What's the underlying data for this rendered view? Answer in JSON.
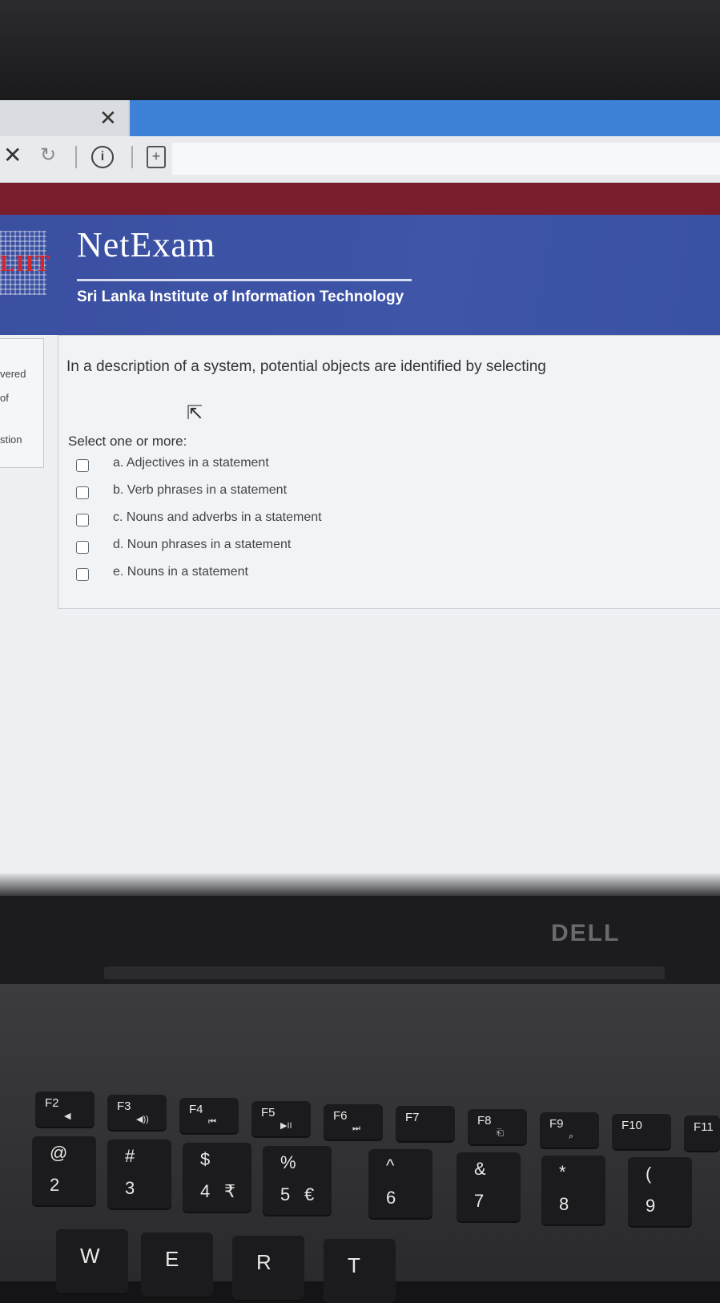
{
  "browser": {
    "tab_close_icon": "close-icon",
    "toolbar_icons": [
      "stop-icon",
      "reload-icon",
      "site-info-icon",
      "extension-icon"
    ]
  },
  "header": {
    "logo_text": "LIIT",
    "brand": "NetExam",
    "institute": "Sri Lanka Institute of Information Technology"
  },
  "sidebar": {
    "line1": "vered",
    "line2": "of",
    "line3": "stion"
  },
  "question": {
    "text": "In a description of a system,  potential objects are identified by selecting",
    "prompt": "Select one or more:",
    "answers": [
      {
        "label": "a. Adjectives in a statement",
        "checked": false
      },
      {
        "label": "b. Verb phrases in a statement",
        "checked": false
      },
      {
        "label": "c. Nouns and adverbs in a statement",
        "checked": false
      },
      {
        "label": "d. Noun phrases in a statement",
        "checked": false
      },
      {
        "label": "e. Nouns in a statement",
        "checked": false
      }
    ]
  },
  "laptop": {
    "brand": "DELL",
    "fkeys": [
      "F2",
      "F3",
      "F4",
      "F5",
      "F6",
      "F7",
      "F8",
      "F9",
      "F10",
      "F11"
    ],
    "fkey_icons": [
      "◀",
      "◀))",
      "⏮",
      "▶II",
      "⏭",
      "",
      "⎗",
      "⌕",
      "",
      ""
    ],
    "number_keys": [
      {
        "top": "@",
        "bottom": "2",
        "alt": ""
      },
      {
        "top": "#",
        "bottom": "3",
        "alt": ""
      },
      {
        "top": "$",
        "bottom": "4",
        "alt": "₹"
      },
      {
        "top": "%",
        "bottom": "5",
        "alt": "€"
      },
      {
        "top": "^",
        "bottom": "6",
        "alt": ""
      },
      {
        "top": "&",
        "bottom": "7",
        "alt": ""
      },
      {
        "top": "*",
        "bottom": "8",
        "alt": ""
      },
      {
        "top": "(",
        "bottom": "9",
        "alt": ""
      }
    ],
    "letter_keys": [
      "W",
      "E",
      "R",
      "T"
    ]
  }
}
